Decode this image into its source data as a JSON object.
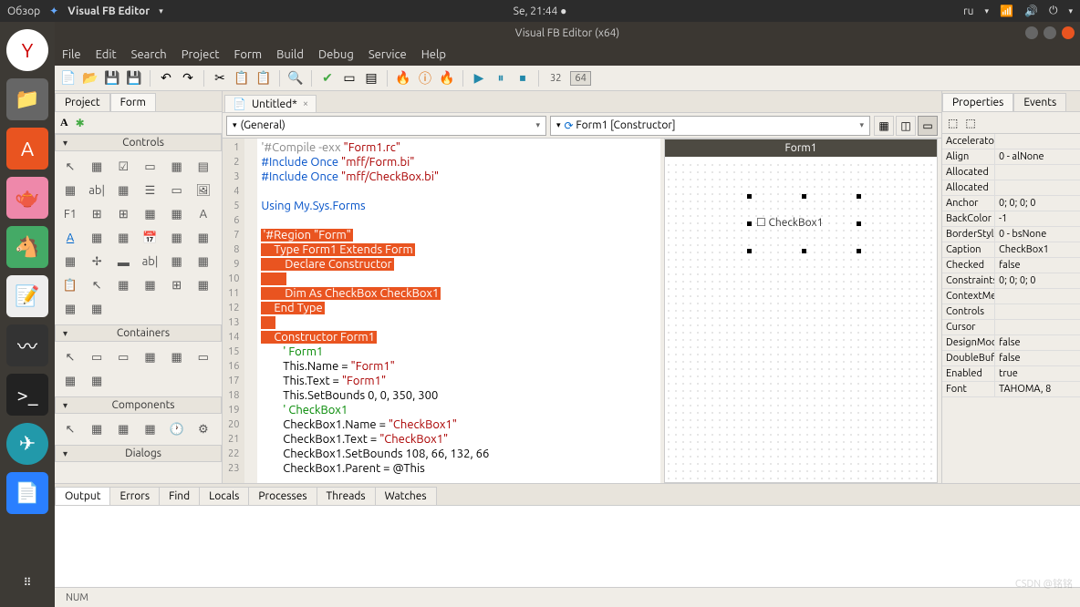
{
  "ubuntu": {
    "left_label": "Обзор",
    "app": "Visual FB Editor",
    "datetime": "Se, 21:44 ●",
    "lang": "ru"
  },
  "window": {
    "title": "Visual FB Editor (x64)"
  },
  "menu": [
    "File",
    "Edit",
    "Search",
    "Project",
    "Form",
    "Build",
    "Debug",
    "Service",
    "Help"
  ],
  "toolbar_numbers": {
    "n1": "32",
    "n2": "64"
  },
  "left_tabs": {
    "a": "Project",
    "b": "Form"
  },
  "sections": {
    "controls": "Controls",
    "containers": "Containers",
    "components": "Components",
    "dialogs": "Dialogs"
  },
  "file_tab": "Untitled*",
  "combo_general": "(General)",
  "combo_form": "Form1 [Constructor]",
  "code_lines": [
    {
      "n": 1,
      "t": "'#Compile -exx \"Form1.rc\"",
      "cls": "kw-dir"
    },
    {
      "n": 2,
      "t": "#Include Once \"mff/Form.bi\"",
      "cls": "kw-blue"
    },
    {
      "n": 3,
      "t": "#Include Once \"mff/CheckBox.bi\"",
      "cls": "kw-blue"
    },
    {
      "n": 4,
      "t": "",
      "cls": ""
    },
    {
      "n": 5,
      "t": "Using My.Sys.Forms",
      "cls": "kw-blue"
    },
    {
      "n": 6,
      "t": "",
      "cls": ""
    },
    {
      "n": 7,
      "t": "'#Region \"Form\"",
      "cls": "hl kw-dir"
    },
    {
      "n": 8,
      "t": "    Type Form1 Extends Form",
      "cls": "hl"
    },
    {
      "n": 9,
      "t": "        Declare Constructor",
      "cls": "hl"
    },
    {
      "n": 10,
      "t": "        ",
      "cls": "hl"
    },
    {
      "n": 11,
      "t": "        Dim As CheckBox CheckBox1",
      "cls": "hl"
    },
    {
      "n": 12,
      "t": "    End Type",
      "cls": "hl"
    },
    {
      "n": 13,
      "t": "    ",
      "cls": "hl"
    },
    {
      "n": 14,
      "t": "    Constructor Form1",
      "cls": "hl"
    },
    {
      "n": 15,
      "t": "        ' Form1",
      "cls": "kw-green"
    },
    {
      "n": 16,
      "t": "        This.Name = \"Form1\"",
      "cls": ""
    },
    {
      "n": 17,
      "t": "        This.Text = \"Form1\"",
      "cls": ""
    },
    {
      "n": 18,
      "t": "        This.SetBounds 0, 0, 350, 300",
      "cls": ""
    },
    {
      "n": 19,
      "t": "        ' CheckBox1",
      "cls": "kw-green"
    },
    {
      "n": 20,
      "t": "        CheckBox1.Name = \"CheckBox1\"",
      "cls": ""
    },
    {
      "n": 21,
      "t": "        CheckBox1.Text = \"CheckBox1\"",
      "cls": ""
    },
    {
      "n": 22,
      "t": "        CheckBox1.SetBounds 108, 66, 132, 66",
      "cls": ""
    },
    {
      "n": 23,
      "t": "        CheckBox1.Parent = @This",
      "cls": ""
    }
  ],
  "designer": {
    "form_title": "Form1",
    "checkbox": "CheckBox1"
  },
  "right_tabs": {
    "a": "Properties",
    "b": "Events"
  },
  "props": [
    {
      "k": "Accelerator",
      "v": ""
    },
    {
      "k": "Align",
      "v": "0 - alNone"
    },
    {
      "k": "Allocated",
      "v": ""
    },
    {
      "k": "Allocated",
      "v": ""
    },
    {
      "k": "Anchor",
      "v": "0; 0; 0; 0"
    },
    {
      "k": "BackColor",
      "v": "-1"
    },
    {
      "k": "BorderStyle",
      "v": "0 - bsNone"
    },
    {
      "k": "Caption",
      "v": "CheckBox1"
    },
    {
      "k": "Checked",
      "v": "false"
    },
    {
      "k": "Constraints",
      "v": "0; 0; 0; 0"
    },
    {
      "k": "ContextMenu",
      "v": ""
    },
    {
      "k": "Controls",
      "v": ""
    },
    {
      "k": "Cursor",
      "v": ""
    },
    {
      "k": "DesignMode",
      "v": "false"
    },
    {
      "k": "DoubleBuffered",
      "v": "false"
    },
    {
      "k": "Enabled",
      "v": "true"
    },
    {
      "k": "Font",
      "v": "TAHOMA, 8"
    }
  ],
  "bottom_tabs": [
    "Output",
    "Errors",
    "Find",
    "Locals",
    "Processes",
    "Threads",
    "Watches"
  ],
  "status": {
    "num": "NUM"
  },
  "watermark": "CSDN @铭铭"
}
